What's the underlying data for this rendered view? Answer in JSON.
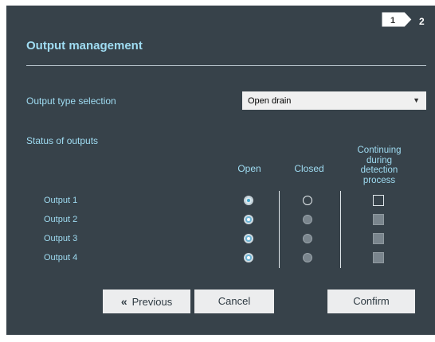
{
  "wizard": {
    "step1": "1",
    "step2": "2"
  },
  "header": {
    "title": "Output management"
  },
  "output_type": {
    "label": "Output type selection",
    "value": "Open drain"
  },
  "status": {
    "label": "Status of outputs",
    "columns": {
      "open": "Open",
      "closed": "Closed",
      "continuing": "Continuing during detection process"
    },
    "rows": [
      {
        "label": "Output 1",
        "open": true,
        "closed": false,
        "continuing": false,
        "enabled": true
      },
      {
        "label": "Output 2",
        "open": true,
        "closed": false,
        "continuing": false,
        "enabled": false
      },
      {
        "label": "Output 3",
        "open": true,
        "closed": false,
        "continuing": false,
        "enabled": false
      },
      {
        "label": "Output 4",
        "open": true,
        "closed": false,
        "continuing": false,
        "enabled": false
      }
    ]
  },
  "buttons": {
    "previous": "Previous",
    "cancel": "Cancel",
    "confirm": "Confirm"
  },
  "colors": {
    "panel": "#37424a",
    "accent": "#9fdcf2"
  }
}
